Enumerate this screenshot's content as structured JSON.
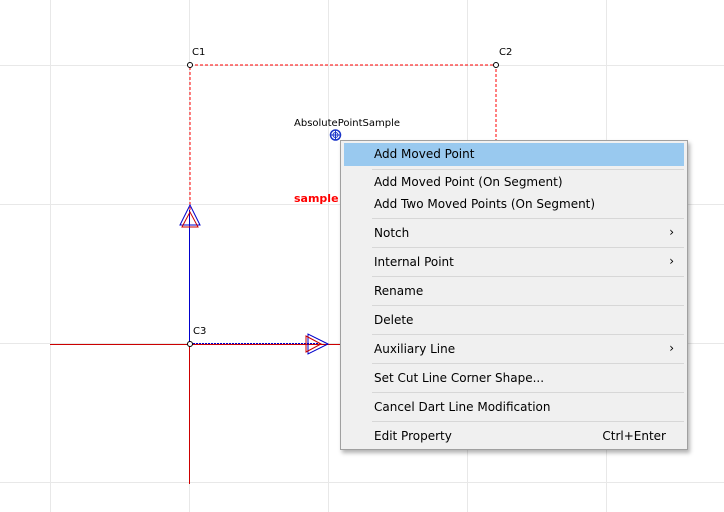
{
  "canvas": {
    "points": {
      "c1": "C1",
      "c2": "C2",
      "c3": "C3",
      "absolute_point": "AbsolutePointSample"
    },
    "piece_label": "sample",
    "colors": {
      "background": "#ffffff",
      "grid": "#e8e8e8",
      "outline": "#ff0000",
      "axis_vertical": "#0000cc",
      "axis_horizontal": "#cc0000",
      "point_marker": "#1a35c8"
    }
  },
  "context_menu": {
    "highlight_color": "#99c9ef",
    "items": [
      {
        "label": "Add Moved Point",
        "highlighted": true
      },
      {
        "label": "Add Moved Point (On Segment)"
      },
      {
        "label": "Add Two Moved Points (On Segment)"
      },
      {
        "label": "Notch",
        "submenu_arrow": "›"
      },
      {
        "label": "Internal Point",
        "submenu_arrow": "›"
      },
      {
        "label": "Rename"
      },
      {
        "label": "Delete"
      },
      {
        "label": "Auxiliary Line",
        "submenu_arrow": "›"
      },
      {
        "label": "Set Cut Line Corner Shape..."
      },
      {
        "label": "Cancel Dart Line Modification"
      },
      {
        "label": "Edit Property",
        "shortcut": "Ctrl+Enter"
      }
    ]
  }
}
